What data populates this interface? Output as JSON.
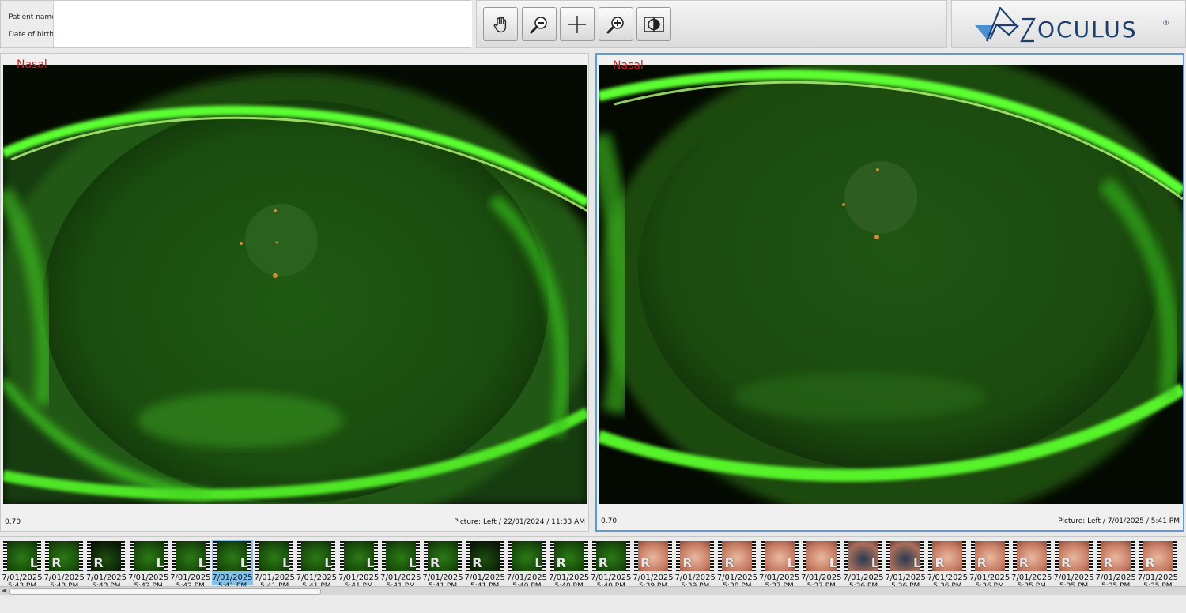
{
  "patient": {
    "name_label": "Patient name:",
    "dob_label": "Date of birth:",
    "name_value": "",
    "dob_value": ""
  },
  "toolbar": {
    "buttons": [
      {
        "name": "pan-button",
        "icon": "hand-icon"
      },
      {
        "name": "zoom-out-button",
        "icon": "zoom-out-icon"
      },
      {
        "name": "crosshair-button",
        "icon": "crosshair-icon"
      },
      {
        "name": "zoom-in-button",
        "icon": "zoom-in-icon"
      },
      {
        "name": "compare-button",
        "icon": "compare-icon"
      }
    ]
  },
  "brand": {
    "name": "OCULUS",
    "mark": "®",
    "color": "#1a3e6e",
    "accent": "#4a8fd1"
  },
  "viewers": [
    {
      "orientation": "Nasal",
      "zoom": "0.70",
      "caption": "Picture: Left / 22/01/2024 / 11:33 AM",
      "active": false
    },
    {
      "orientation": "Nasal",
      "zoom": "0.70",
      "caption": "Picture: Left / 7/01/2025 / 5:41 PM",
      "active": true
    }
  ],
  "filmstrip": [
    {
      "eye": "L",
      "date": "7/01/2025",
      "time": "5:43 PM",
      "kind": "green"
    },
    {
      "eye": "R",
      "date": "7/01/2025",
      "time": "5:43 PM",
      "kind": "green"
    },
    {
      "eye": "R",
      "date": "7/01/2025",
      "time": "5:43 PM",
      "kind": "dark"
    },
    {
      "eye": "L",
      "date": "7/01/2025",
      "time": "5:42 PM",
      "kind": "green"
    },
    {
      "eye": "L",
      "date": "7/01/2025",
      "time": "5:42 PM",
      "kind": "green"
    },
    {
      "eye": "L",
      "date": "7/01/2025",
      "time": "5:41 PM",
      "kind": "green",
      "selected": true
    },
    {
      "eye": "L",
      "date": "7/01/2025",
      "time": "5:41 PM",
      "kind": "green"
    },
    {
      "eye": "L",
      "date": "7/01/2025",
      "time": "5:41 PM",
      "kind": "green"
    },
    {
      "eye": "L",
      "date": "7/01/2025",
      "time": "5:41 PM",
      "kind": "green"
    },
    {
      "eye": "L",
      "date": "7/01/2025",
      "time": "5:41 PM",
      "kind": "green"
    },
    {
      "eye": "R",
      "date": "7/01/2025",
      "time": "5:41 PM",
      "kind": "green"
    },
    {
      "eye": "R",
      "date": "7/01/2025",
      "time": "5:41 PM",
      "kind": "dark"
    },
    {
      "eye": "L",
      "date": "7/01/2025",
      "time": "5:40 PM",
      "kind": "green"
    },
    {
      "eye": "R",
      "date": "7/01/2025",
      "time": "5:40 PM",
      "kind": "green"
    },
    {
      "eye": "R",
      "date": "7/01/2025",
      "time": "5:40 PM",
      "kind": "green"
    },
    {
      "eye": "R",
      "date": "7/01/2025",
      "time": "5:39 PM",
      "kind": "skin"
    },
    {
      "eye": "R",
      "date": "7/01/2025",
      "time": "5:39 PM",
      "kind": "skin"
    },
    {
      "eye": "R",
      "date": "7/01/2025",
      "time": "5:38 PM",
      "kind": "skin"
    },
    {
      "eye": "L",
      "date": "7/01/2025",
      "time": "5:37 PM",
      "kind": "skin"
    },
    {
      "eye": "L",
      "date": "7/01/2025",
      "time": "5:37 PM",
      "kind": "skin"
    },
    {
      "eye": "L",
      "date": "7/01/2025",
      "time": "5:36 PM",
      "kind": "blue"
    },
    {
      "eye": "L",
      "date": "7/01/2025",
      "time": "5:36 PM",
      "kind": "blue"
    },
    {
      "eye": "R",
      "date": "7/01/2025",
      "time": "5:36 PM",
      "kind": "skin"
    },
    {
      "eye": "R",
      "date": "7/01/2025",
      "time": "5:36 PM",
      "kind": "skin"
    },
    {
      "eye": "R",
      "date": "7/01/2025",
      "time": "5:35 PM",
      "kind": "skin"
    },
    {
      "eye": "R",
      "date": "7/01/2025",
      "time": "5:35 PM",
      "kind": "skin"
    },
    {
      "eye": "R",
      "date": "7/01/2025",
      "time": "5:35 PM",
      "kind": "skin"
    },
    {
      "eye": "R",
      "date": "7/01/2025",
      "time": "5:35 PM",
      "kind": "skin"
    }
  ]
}
